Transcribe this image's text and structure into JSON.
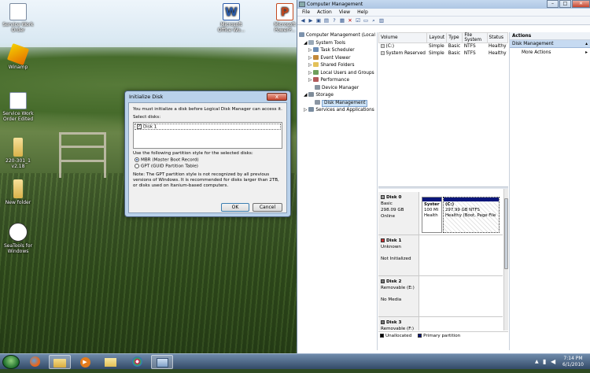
{
  "desktop": {
    "icons": [
      {
        "label": "Service Work Order",
        "icon": "document-icon"
      },
      {
        "label": "Winamp",
        "icon": "winamp-icon"
      },
      {
        "label": "Service Work Order Edited",
        "icon": "document-icon"
      },
      {
        "label": "220-301_1 v2.18",
        "icon": "folder-icon"
      },
      {
        "label": "New folder",
        "icon": "folder-icon"
      },
      {
        "label": "SeaTools for Windows",
        "icon": "seatools-icon"
      },
      {
        "label": "Microsoft Office Wo...",
        "icon": "word-icon"
      },
      {
        "label": "Microsoft PowerP...",
        "icon": "powerpoint-icon"
      }
    ]
  },
  "dialog": {
    "title": "Initialize Disk",
    "intro": "You must initialize a disk before Logical Disk Manager can access it.",
    "select_label": "Select disks:",
    "disk_item": "Disk 1",
    "partition_label": "Use the following partition style for the selected disks:",
    "mbr_label": "MBR (Master Boot Record)",
    "gpt_label": "GPT (GUID Partition Table)",
    "note": "Note: The GPT partition style is not recognized by all previous versions of Windows. It is recommended for disks larger than 2TB, or disks used on Itanium-based computers.",
    "ok": "OK",
    "cancel": "Cancel",
    "close": "x"
  },
  "cm": {
    "title": "Computer Management",
    "menu": [
      "File",
      "Action",
      "View",
      "Help"
    ],
    "tree": {
      "root": "Computer Management (Local",
      "system_tools": "System Tools",
      "task_scheduler": "Task Scheduler",
      "event_viewer": "Event Viewer",
      "shared_folders": "Shared Folders",
      "local_users": "Local Users and Groups",
      "performance": "Performance",
      "device_manager": "Device Manager",
      "storage": "Storage",
      "disk_management": "Disk Management",
      "services": "Services and Applications"
    },
    "volume_headers": [
      "Volume",
      "Layout",
      "Type",
      "File System",
      "Status"
    ],
    "volumes": [
      [
        "(C:)",
        "Simple",
        "Basic",
        "NTFS",
        "Healthy"
      ],
      [
        "System Reserved",
        "Simple",
        "Basic",
        "NTFS",
        "Healthy"
      ]
    ],
    "disks": {
      "d0_name": "Disk 0",
      "d0_type": "Basic",
      "d0_size": "298.09 GB",
      "d0_state": "Online",
      "p1_name": "Syster",
      "p1_size": "100 MI",
      "p1_status": "Health",
      "p2_name": "(C:)",
      "p2_size": "297.99 GB NTFS",
      "p2_status": "Healthy (Boot, Page File",
      "d1_name": "Disk 1",
      "d1_type": "Unknown",
      "d1_state": "Not Initialized",
      "d2_name": "Disk 2",
      "d2_type": "Removable (E:)",
      "d2_state": "No Media",
      "d3_name": "Disk 3",
      "d3_type": "Removable (F:)"
    },
    "legend": {
      "unallocated": "Unallocated",
      "primary": "Primary partition"
    },
    "actions": {
      "header": "Actions",
      "section": "Disk Management",
      "more": "More Actions"
    }
  },
  "taskbar": {
    "time": "7:14 PM",
    "date": "6/1/2010"
  },
  "colors": {
    "primary_partition": "#0a167a",
    "titlebar": "#b9d1ea"
  }
}
